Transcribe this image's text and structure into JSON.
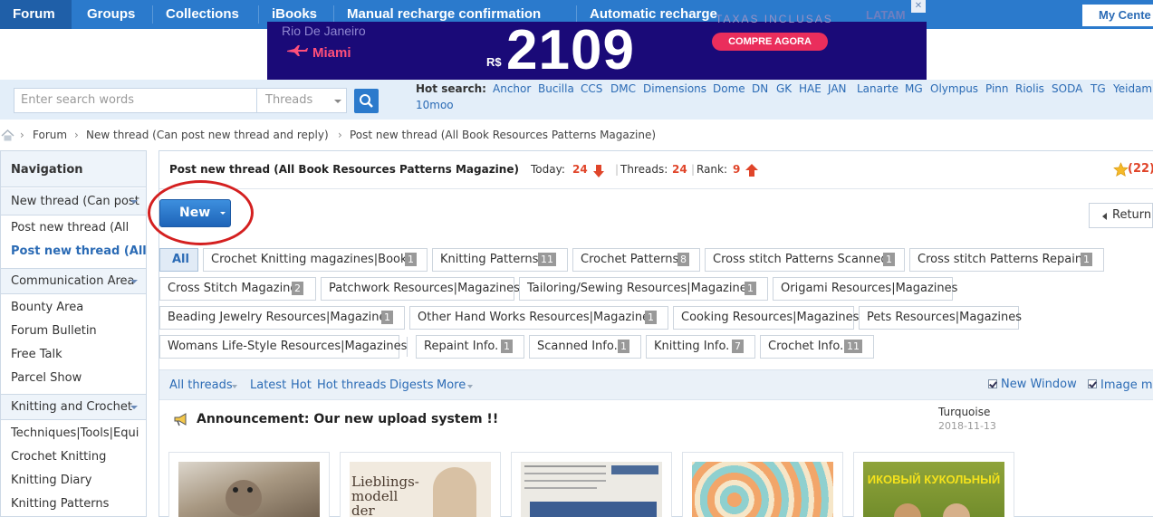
{
  "nav": {
    "items": [
      {
        "label": "Forum",
        "active": true
      },
      {
        "label": "Groups"
      },
      {
        "label": "Collections"
      },
      {
        "label": "iBooks"
      },
      {
        "label": "Manual recharge confirmation"
      },
      {
        "label": "Automatic recharge"
      }
    ],
    "my_center": "My Cente"
  },
  "ad": {
    "city": "Rio De Janeiro",
    "destination": "Miami",
    "currency": "R$",
    "price": "2109",
    "cta": "COMPRE AGORA",
    "taxes": "TAXAS INCLUSAS",
    "brand": "LATAM",
    "close_icon": "✕"
  },
  "search": {
    "placeholder": "Enter search words",
    "scope": "Threads",
    "hot_label": "Hot search:",
    "hot_words": [
      "Anchor",
      "Bucilla",
      "CCS",
      "DMC",
      "Dimensions",
      "Dome",
      "DN",
      "GK",
      "HAE",
      "JAN",
      "Lanarte",
      "MG",
      "Olympus",
      "Pinn",
      "Riolis",
      "SODA",
      "TG",
      "Yeidam",
      "10moo"
    ]
  },
  "breadcrumb": [
    "Forum",
    "New thread (Can post new thread and reply)",
    "Post new thread (All Book Resources Patterns Magazine)"
  ],
  "sidebar": {
    "heading": "Navigation",
    "groups": [
      {
        "label": "New thread (Can post",
        "items": [
          "Post new thread (All",
          "Post new thread (All"
        ]
      },
      {
        "label": "Communication Area",
        "items": [
          "Bounty Area",
          "Forum Bulletin",
          "Free Talk",
          "Parcel Show"
        ]
      },
      {
        "label": "Knitting and Crochet",
        "items": [
          "Techniques|Tools|Equi",
          "Crochet Knitting",
          "Knitting Diary",
          "Knitting Patterns"
        ]
      }
    ]
  },
  "forum": {
    "title": "Post new thread (All Book Resources Patterns Magazine)",
    "today_label": "Today:",
    "today_value": "24",
    "threads_label": "Threads:",
    "threads_value": "24",
    "rank_label": "Rank:",
    "rank_value": "9",
    "favorites": "(22)",
    "new_button": "New",
    "return_button": "Return"
  },
  "tags": [
    {
      "label": "All"
    },
    {
      "label": "Crochet Knitting magazines|Books",
      "count": "1"
    },
    {
      "label": "Knitting Patterns",
      "count": "11"
    },
    {
      "label": "Crochet Patterns",
      "count": "8"
    },
    {
      "label": "Cross stitch Patterns Scanned",
      "count": "1"
    },
    {
      "label": "Cross stitch Patterns Repaint",
      "count": "1"
    },
    {
      "label": "Cross Stitch Magazine",
      "count": "2"
    },
    {
      "label": "Patchwork Resources|Magazines"
    },
    {
      "label": "Tailoring/Sewing Resources|Magazines",
      "count": "1"
    },
    {
      "label": "Origami Resources|Magazines"
    },
    {
      "label": "Beading Jewelry Resources|Magazines",
      "count": "1"
    },
    {
      "label": "Other Hand Works Resources|Magazines",
      "count": "1"
    },
    {
      "label": "Cooking Resources|Magazines"
    },
    {
      "label": "Pets Resources|Magazines"
    },
    {
      "label": "Womans Life-Style Resources|Magazines"
    },
    {
      "label": "Repaint Info.",
      "count": "1"
    },
    {
      "label": "Scanned Info.",
      "count": "1"
    },
    {
      "label": "Knitting Info.",
      "count": "7"
    },
    {
      "label": "Crochet Info.",
      "count": "11"
    }
  ],
  "threadbar": {
    "all_threads": "All threads",
    "latest": "Latest",
    "hot": "Hot",
    "hot_threads": "Hot threads",
    "digests": "Digests",
    "more": "More",
    "new_window": "New Window",
    "image_mode": "Image mo"
  },
  "announcement": {
    "title": "Announcement: Our new upload system !!",
    "author": "Turquoise",
    "date": "2018-11-13"
  },
  "thumbnails": [
    {
      "caption": ""
    },
    {
      "caption": "Lieblings- modell der Redaktion"
    },
    {
      "caption": ""
    },
    {
      "caption": ""
    },
    {
      "caption": "ИКОВЫЙ КУКОЛЬНЫЙ"
    }
  ],
  "colors": {
    "nav_bg": "#2b7acc",
    "link": "#2b6bb5",
    "accent_red": "#e0452a"
  }
}
